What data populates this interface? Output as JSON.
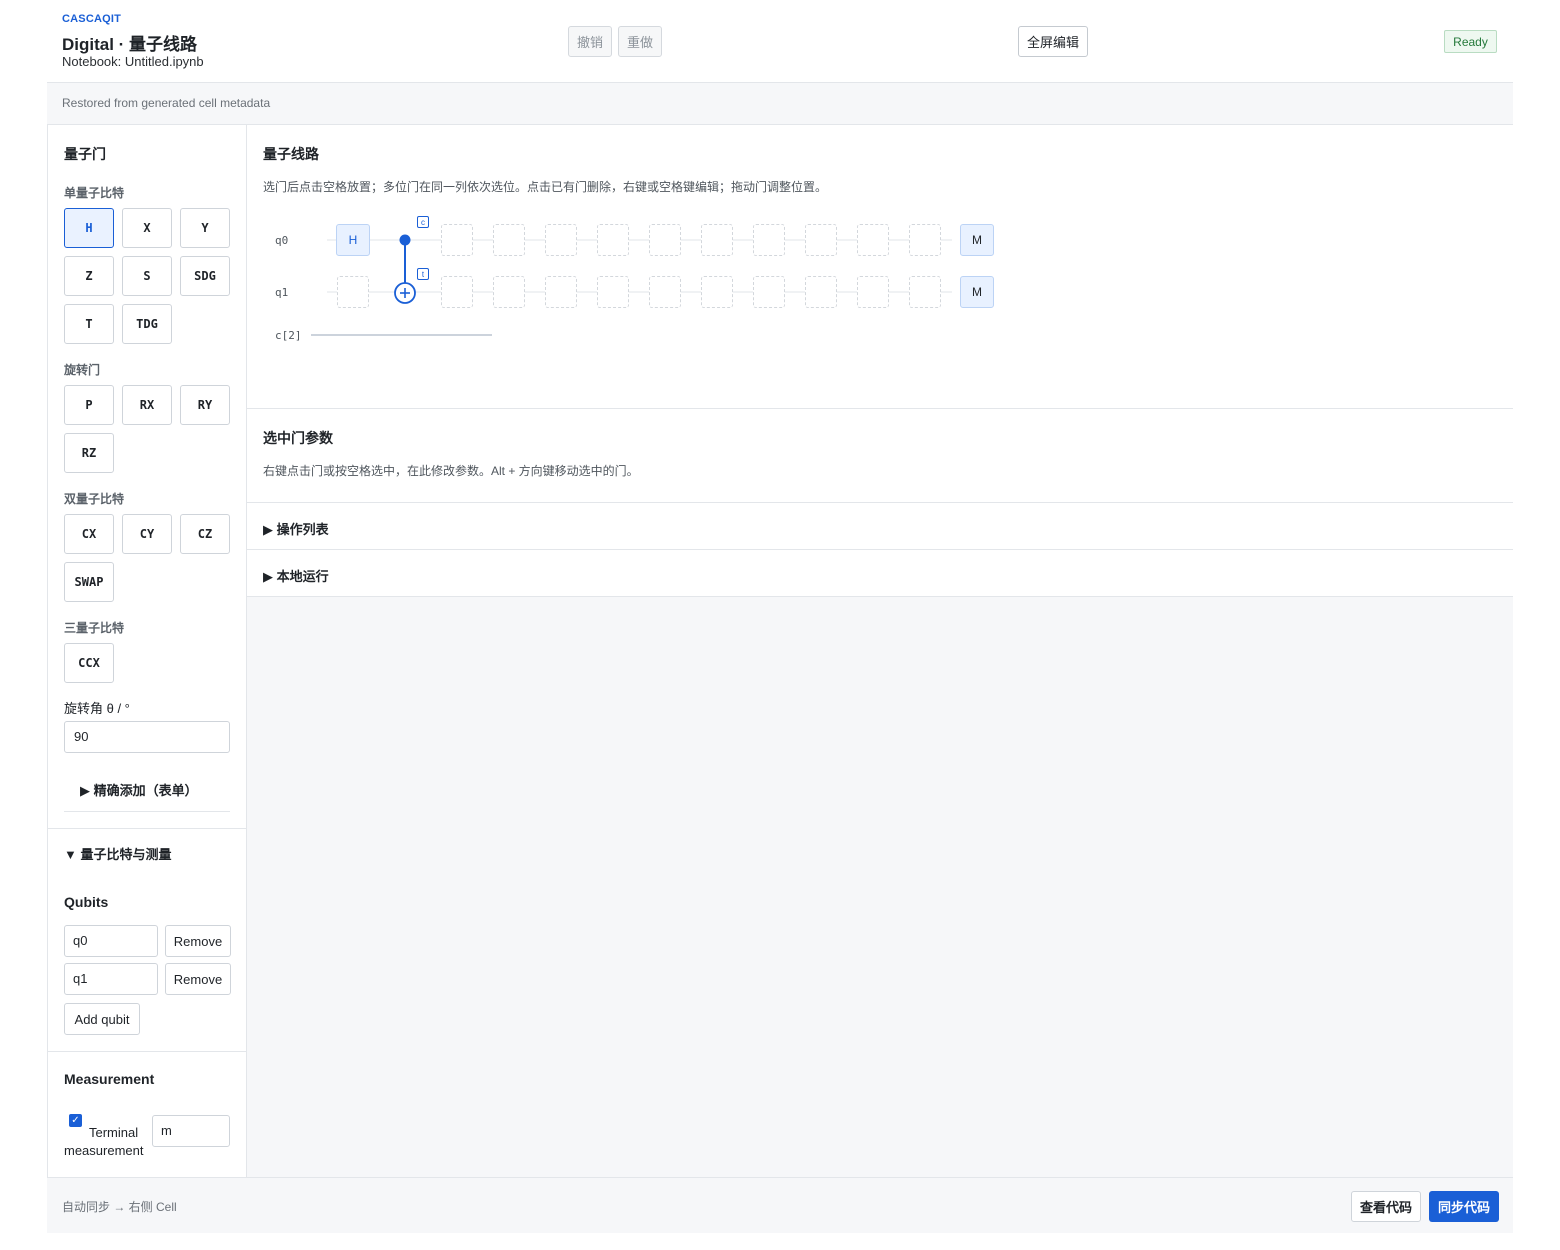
{
  "header": {
    "brand": "CASCAQIT",
    "title": "Digital · 量子线路",
    "notebook": "Notebook: Untitled.ipynb",
    "undo": "撤销",
    "redo": "重做",
    "fullscreen": "全屏编辑",
    "status": "Ready"
  },
  "status_strip": "Restored from generated cell metadata",
  "sidebar": {
    "title": "量子门",
    "groups": {
      "single": {
        "title": "单量子比特",
        "gates": [
          "H",
          "X",
          "Y",
          "Z",
          "S",
          "SDG",
          "T",
          "TDG"
        ]
      },
      "rotation": {
        "title": "旋转门",
        "gates": [
          "P",
          "RX",
          "RY",
          "RZ"
        ]
      },
      "two": {
        "title": "双量子比特",
        "gates": [
          "CX",
          "CY",
          "CZ",
          "SWAP"
        ]
      },
      "three": {
        "title": "三量子比特",
        "gates": [
          "CCX"
        ]
      }
    },
    "selected_gate": "H",
    "angle_label": "旋转角 θ / °",
    "angle_value": "90",
    "precise_add": "▶ 精确添加（表单）",
    "qubits_measure": "▼ 量子比特与测量",
    "qubits_title": "Qubits",
    "qubits": [
      "q0",
      "q1"
    ],
    "remove_label": "Remove",
    "add_qubit": "Add qubit",
    "measurement_title": "Measurement",
    "terminal_checked": true,
    "terminal_label": "Terminal measurement",
    "terminal_value": "m"
  },
  "circuit": {
    "title": "量子线路",
    "description": "选门后点击空格放置；多位门在同一列依次选位。点击已有门删除，右键或空格键编辑；拖动门调整位置。",
    "wires": [
      "q0",
      "q1"
    ],
    "classical": "c[2]",
    "gate_h": "H",
    "control_tag": "c",
    "target_tag": "t",
    "measure": "M"
  },
  "params": {
    "title": "选中门参数",
    "description": "右键点击门或按空格选中，在此修改参数。Alt + 方向键移动选中的门。"
  },
  "ops_list": "▶ 操作列表",
  "local_run": "▶ 本地运行",
  "footer": {
    "sync_text": "自动同步 → 右侧 Cell",
    "view_code": "查看代码",
    "sync_code": "同步代码"
  }
}
